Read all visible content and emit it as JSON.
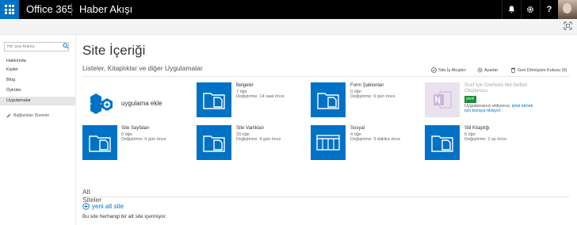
{
  "topbar": {
    "brand": "Office 365",
    "app_name": "Haber Akışı",
    "bell_icon": "bell-icon",
    "gear_icon": "gear-icon",
    "help_label": "?"
  },
  "sidebar": {
    "search_placeholder": "Her şeyi Arama",
    "items": [
      {
        "label": "Hakkımda"
      },
      {
        "label": "Kişiler"
      },
      {
        "label": "Blog"
      },
      {
        "label": "Öyküler"
      },
      {
        "label": "Uygulamalar"
      }
    ],
    "edit_links": "Bağlantıları Düzenle"
  },
  "main": {
    "title": "Site İçeriği",
    "subtitle": "Listeler, Kitaplıklar ve diğer Uygulamalar",
    "actions": {
      "workflows": "Site İş Akışları",
      "settings": "Ayarlar",
      "recycle": "Geri Dönüşüm Kutusu (9)"
    },
    "add_app": "uygulama ekle",
    "tiles": [
      {
        "title": "Belgeler",
        "count": "7 öğe",
        "modified": "Değiştirme: 14 saat önce"
      },
      {
        "title": "Form Şablonları",
        "count": "0 öğe",
        "modified": "Değiştirme: 6 gün önce"
      },
      {
        "title": "Sınıf İçin OneNote Not Defteri Oluşturucu",
        "badge": "yeni!",
        "desc": "Uygulamanızı ekliyoruz,",
        "link1": "iptal",
        "link2": "etmek için buraya tıklayın."
      },
      {
        "title": "Site Sayfaları",
        "count": "0 öğe",
        "modified": "Değiştirme: 6 gün önce"
      },
      {
        "title": "Site Varlıkları",
        "count": "20 öğe",
        "modified": "Değiştirme: 4 gün önce"
      },
      {
        "title": "Sosyal",
        "count": "4 öğe",
        "modified": "Değiştirme: 9 dakika önce"
      },
      {
        "title": "Stil Kitaplığı",
        "count": "0 öğe",
        "modified": "Değiştirme: 2 ay önce"
      }
    ],
    "subsites_title": "Alt Siteler",
    "new_subsite": "yeni alt site",
    "empty_msg": "Bu site herhangi bir alt site içermiyor."
  },
  "colors": {
    "accent": "#0072c6",
    "topbar": "#000000",
    "badge": "#1e8c3b",
    "onenote": "#e9e2ee"
  }
}
